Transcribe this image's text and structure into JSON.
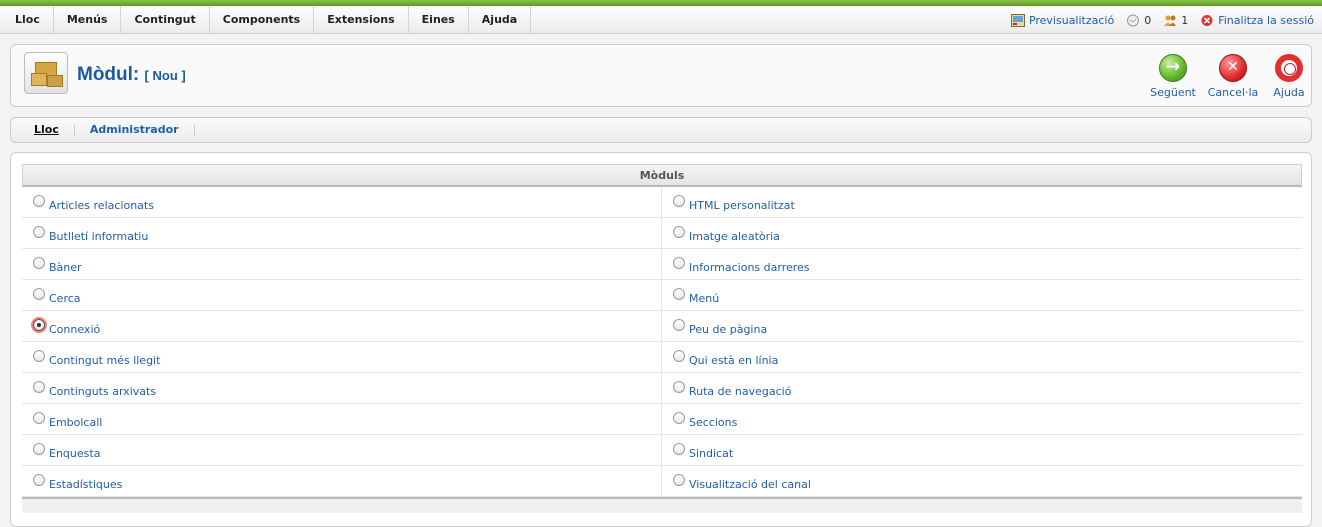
{
  "menubar": {
    "items": [
      "Lloc",
      "Menús",
      "Contingut",
      "Components",
      "Extensions",
      "Eines",
      "Ajuda"
    ],
    "preview_label": "Previsualització",
    "messages_count": "0",
    "users_count": "1",
    "logout_label": "Finalitza la sessió"
  },
  "header": {
    "title": "Mòdul:",
    "subtitle": "[ Nou ]",
    "buttons": {
      "next": "Següent",
      "cancel": "Cancel·la",
      "help": "Ajuda"
    }
  },
  "submenu": {
    "items": [
      "Lloc",
      "Administrador"
    ],
    "active": "Lloc"
  },
  "modules": {
    "heading": "Mòduls",
    "selected": "Connexió",
    "left": [
      "Articles relacionats",
      "Butlletí informatiu",
      "Bàner",
      "Cerca",
      "Connexió",
      "Contingut més llegit",
      "Continguts arxivats",
      "Embolcall",
      "Enquesta",
      "Estadístiques"
    ],
    "right": [
      "HTML personalitzat",
      "Imatge aleatòria",
      "Informacions darreres",
      "Menú",
      "Peu de pàgina",
      "Qui està en línia",
      "Ruta de navegació",
      "Seccions",
      "Sindicat",
      "Visualització del canal"
    ]
  },
  "colors": {
    "link": "#1f5fa9",
    "top_line": "#6aa82a",
    "title": "#1c5aa6"
  }
}
